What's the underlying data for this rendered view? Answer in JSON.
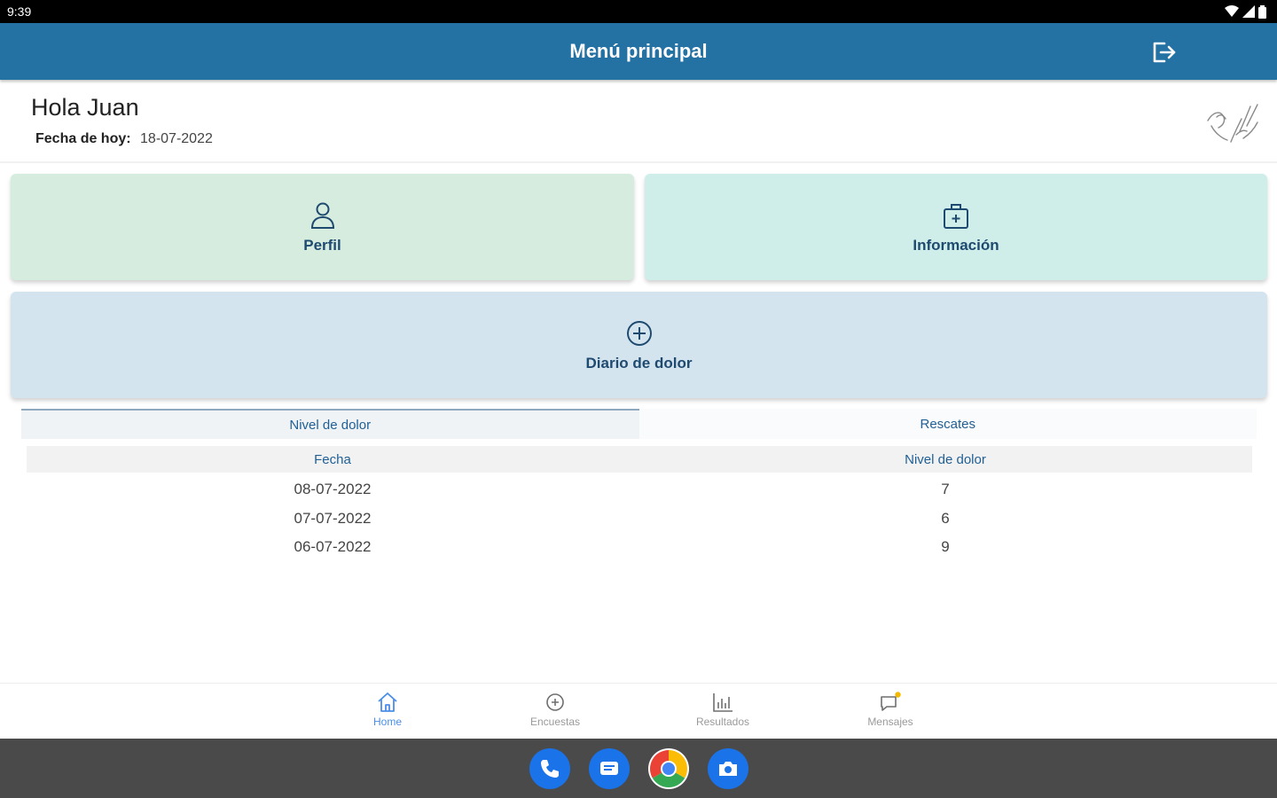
{
  "status": {
    "time": "9:39"
  },
  "appbar": {
    "title": "Menú principal",
    "logout_icon": "logout-icon"
  },
  "greeting": {
    "hello": "Hola Juan",
    "date_label": "Fecha de hoy:",
    "date_value": "18-07-2022"
  },
  "cards": {
    "perfil": {
      "label": "Perfil",
      "icon": "person-icon"
    },
    "informacion": {
      "label": "Información",
      "icon": "medical-kit-icon"
    },
    "diario": {
      "label": "Diario de dolor",
      "icon": "plus-circle-icon"
    }
  },
  "tabs": [
    {
      "label": "Nivel de dolor",
      "active": true
    },
    {
      "label": "Rescates",
      "active": false
    }
  ],
  "table": {
    "headers": [
      "Fecha",
      "Nivel de dolor"
    ],
    "rows": [
      [
        "08-07-2022",
        "7"
      ],
      [
        "07-07-2022",
        "6"
      ],
      [
        "06-07-2022",
        "9"
      ]
    ]
  },
  "bottom_nav": [
    {
      "label": "Home",
      "icon": "home-icon",
      "active": true
    },
    {
      "label": "Encuestas",
      "icon": "plus-circle-icon",
      "active": false
    },
    {
      "label": "Resultados",
      "icon": "bar-chart-icon",
      "active": false
    },
    {
      "label": "Mensajes",
      "icon": "message-icon",
      "active": false
    }
  ],
  "colors": {
    "appbar": "#2471a3",
    "perfil_card": "#d5ecdf",
    "info_card": "#d0eee9",
    "diario_card": "#d4e4ef",
    "accent_text": "#1f5f95",
    "nav_active": "#4a8ee8"
  },
  "dock_apps": [
    "phone-app-icon",
    "messages-app-icon",
    "chrome-app-icon",
    "camera-app-icon"
  ]
}
